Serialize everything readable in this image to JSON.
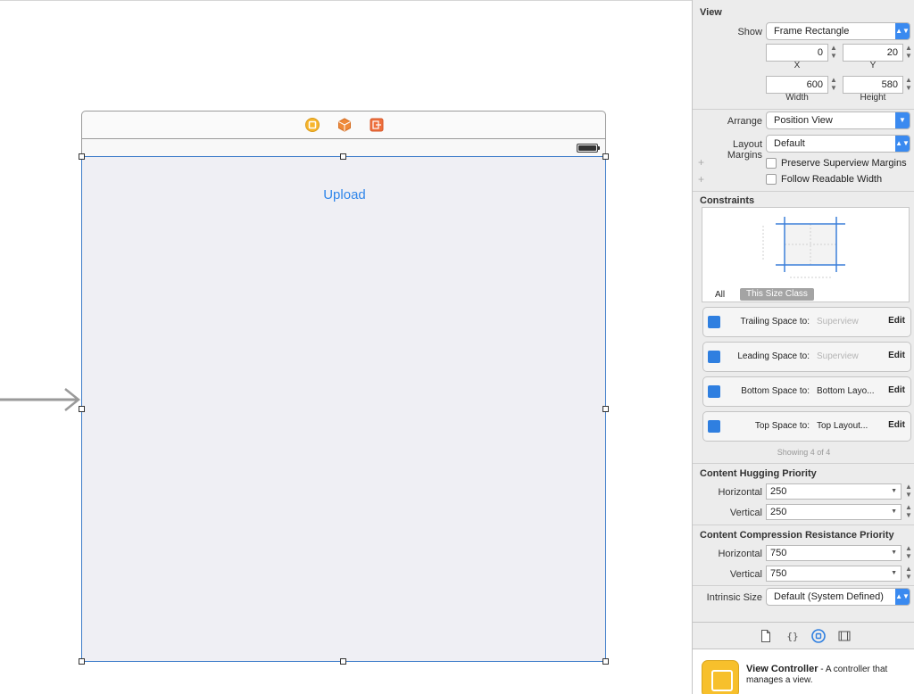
{
  "canvas": {
    "upload_button": "Upload"
  },
  "inspector": {
    "view_section": "View",
    "show_label": "Show",
    "show_value": "Frame Rectangle",
    "x_value": "0",
    "x_label": "X",
    "y_value": "20",
    "y_label": "Y",
    "width_value": "600",
    "width_label": "Width",
    "height_value": "580",
    "height_label": "Height",
    "arrange_label": "Arrange",
    "arrange_value": "Position View",
    "layout_margins_label": "Layout Margins",
    "layout_margins_value": "Default",
    "preserve_margins": "Preserve Superview Margins",
    "follow_readable": "Follow Readable Width",
    "constraints_section": "Constraints",
    "tab_all": "All",
    "tab_size_class": "This Size Class",
    "constraints": [
      {
        "label": "Trailing Space to:",
        "value": "Superview",
        "edit": "Edit"
      },
      {
        "label": "Leading Space to:",
        "value": "Superview",
        "edit": "Edit"
      },
      {
        "label": "Bottom Space to:",
        "value": "Bottom Layo...",
        "edit": "Edit"
      },
      {
        "label": "Top Space to:",
        "value": "Top Layout...",
        "edit": "Edit"
      }
    ],
    "showing": "Showing 4 of 4",
    "hugging_section": "Content Hugging Priority",
    "hugging_h_label": "Horizontal",
    "hugging_h_value": "250",
    "hugging_v_label": "Vertical",
    "hugging_v_value": "250",
    "compression_section": "Content Compression Resistance Priority",
    "compression_h_label": "Horizontal",
    "compression_h_value": "750",
    "compression_v_label": "Vertical",
    "compression_v_value": "750",
    "intrinsic_label": "Intrinsic Size",
    "intrinsic_value": "Default (System Defined)"
  },
  "library": {
    "name": "View Controller",
    "description": " - A controller that manages a view."
  },
  "colors": {
    "accent": "#2f86ea",
    "selection": "#3d7cc9",
    "vc_yellow": "#f7c02c"
  }
}
